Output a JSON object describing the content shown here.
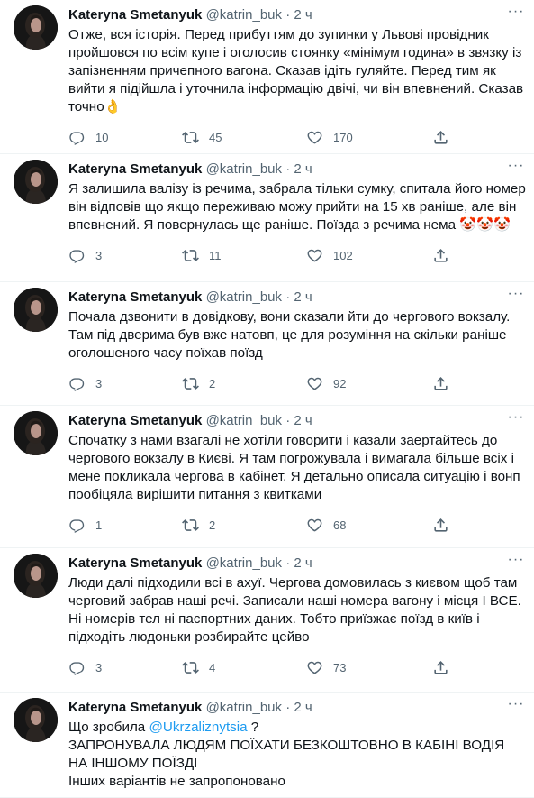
{
  "colors": {
    "text": "#0f1419",
    "muted": "#536471",
    "link": "#1d9bf0"
  },
  "icons": {
    "reply": "reply-icon",
    "retweet": "retweet-icon",
    "like": "heart-icon",
    "share": "share-icon",
    "more": "more-icon"
  },
  "more_glyph": "···",
  "dot": "·",
  "tweets": [
    {
      "name": "Kateryna Smetanyuk",
      "handle": "@katrin_buk",
      "time": "2 ч",
      "text": "Отже, вся історія. Перед прибуттям до зупинки у Львові провідник пройшовся по всім купе і оголосив стоянку «мінімум година» в звязку із запізненням причепного вагона. Сказав ідіть гуляйте. Перед тим як вийти я підійшла і уточнила інформацію двічі, чи він впевнений. Сказав точно👌",
      "replies": "10",
      "retweets": "45",
      "likes": "170"
    },
    {
      "name": "Kateryna Smetanyuk",
      "handle": "@katrin_buk",
      "time": "2 ч",
      "text": "Я залишила валізу із речима, забрала тільки сумку, спитала його номер він відповів що якщо переживаю можу прийти на 15 хв раніше, але він впевнений. Я повернулась ще раніше. Поїзда з речима нема 🤡🤡🤡",
      "replies": "3",
      "retweets": "11",
      "likes": "102"
    },
    {
      "name": "Kateryna Smetanyuk",
      "handle": "@katrin_buk",
      "time": "2 ч",
      "text": "Почала дзвонити в довідкову, вони сказали йти до чергового вокзалу. Там під дверима був вже натовп, це для розуміння на скільки раніше оголошеного часу поїхав поїзд",
      "replies": "3",
      "retweets": "2",
      "likes": "92"
    },
    {
      "name": "Kateryna Smetanyuk",
      "handle": "@katrin_buk",
      "time": "2 ч",
      "text": "Спочатку з нами взагалі не хотіли говорити і казали заертайтесь до чергового вокзалу в Києві. Я там погрожувала і вимагала більше всіх і мене покликала чергова в кабінет. Я детально описала ситуацію і вонп пообіцяла вирішити питання з квитками",
      "replies": "1",
      "retweets": "2",
      "likes": "68"
    },
    {
      "name": "Kateryna Smetanyuk",
      "handle": "@katrin_buk",
      "time": "2 ч",
      "text": "Люди далі підходили всі в ахуї. Чергова домовилась з києвом щоб там черговий забрав наші речі. Записали наші номера вагону і місця І ВСЕ. Ні номерів тел ні паспортних даних. Тобто приїзжає поїзд в київ і підходіть людоньки розбирайте цейво",
      "replies": "3",
      "retweets": "4",
      "likes": "73"
    },
    {
      "name": "Kateryna Smetanyuk",
      "handle": "@katrin_buk",
      "time": "2 ч",
      "text_before": "Що зробила ",
      "mention": "@Ukrzaliznytsia",
      "text_after": " ?\nЗАПРОНУВАЛА ЛЮДЯМ ПОЇХАТИ БЕЗКОШТОВНО В КАБІНІ ВОДІЯ НА ІНШОМУ ПОЇЗДІ\nІнших варіантів не запропоновано"
    }
  ]
}
